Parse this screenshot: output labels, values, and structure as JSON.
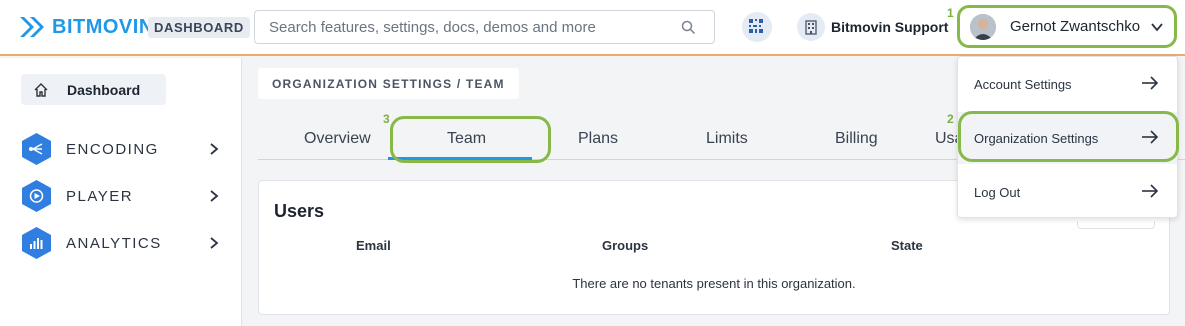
{
  "header": {
    "brand": "BITMOVIN",
    "badge": "DASHBOARD",
    "search_placeholder": "Search features, settings, docs, demos and more",
    "org_name": "Bitmovin Support",
    "user_name": "Gernot Zwantschko",
    "accent_color": "#1f98e8",
    "highlight_color": "#86b947"
  },
  "sidebar": {
    "dashboard_label": "Dashboard",
    "items": [
      {
        "label": "ENCODING",
        "icon": "encoding-icon"
      },
      {
        "label": "PLAYER",
        "icon": "player-icon"
      },
      {
        "label": "ANALYTICS",
        "icon": "analytics-icon"
      }
    ]
  },
  "breadcrumb": "ORGANIZATION SETTINGS / TEAM",
  "tabs": [
    {
      "label": "Overview"
    },
    {
      "label": "Team",
      "active": true
    },
    {
      "label": "Plans"
    },
    {
      "label": "Limits"
    },
    {
      "label": "Billing"
    },
    {
      "label": "Usa"
    }
  ],
  "users": {
    "title": "Users",
    "columns": [
      "Email",
      "Groups",
      "State"
    ],
    "empty_message": "There are no tenants present in this organization."
  },
  "dropdown": {
    "items": [
      {
        "label": "Account Settings"
      },
      {
        "label": "Organization Settings"
      },
      {
        "label": "Log Out"
      }
    ]
  },
  "annotations": {
    "step_1": "1",
    "step_2": "2",
    "step_3": "3"
  }
}
